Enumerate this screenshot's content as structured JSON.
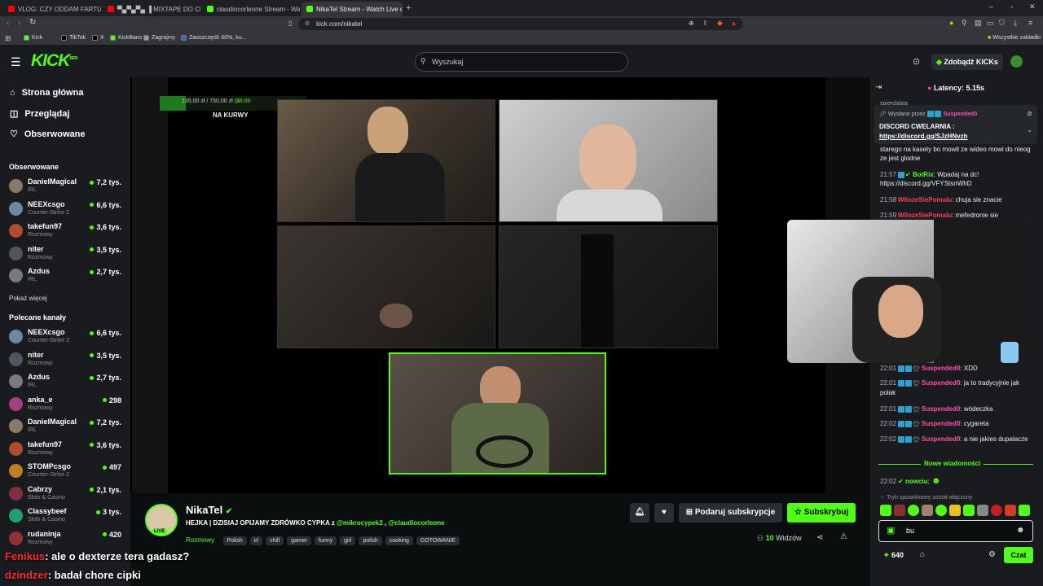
{
  "browser": {
    "tabs": [
      {
        "title": "VLOG: CZY ODDAM FARTUCHA? ‼",
        "color": "#ff0000"
      },
      {
        "title": "▀▄▀▄▀▄ ▐ MIXTAPE DO CH...",
        "color": "#ff0000"
      },
      {
        "title": "claudiocorleone Stream - Watch",
        "color": "#53fc18"
      },
      {
        "title": "NikaTel Stream - Watch Live o",
        "color": "#53fc18"
      }
    ],
    "url": "kick.com/nikatel",
    "bookmarks": [
      "Kick",
      "TikTok",
      "X",
      "KickBans",
      "Zagrajmy",
      "Zaoszczędź 60%, ku..."
    ],
    "all_bookmarks": "Wszystkie zakładki"
  },
  "header": {
    "logo": "KICK",
    "logo_sup": "BETA",
    "search_placeholder": "Wyszukaj",
    "kicks_button": "Zdobądź KICKs"
  },
  "sidebar": {
    "nav": [
      {
        "label": "Strona główna",
        "icon": "home-icon"
      },
      {
        "label": "Przeglądaj",
        "icon": "browse-icon"
      },
      {
        "label": "Obserwowane",
        "icon": "heart-icon"
      }
    ],
    "followed_title": "Obserwowane",
    "followed": [
      {
        "name": "DanielMagical",
        "category": "IRL",
        "viewers": "7,2 tys.",
        "color": "#8a7a6a"
      },
      {
        "name": "NEEXcsgo",
        "category": "Counter-Strike 2",
        "viewers": "6,6 tys.",
        "color": "#6a8aa0"
      },
      {
        "name": "takefun97",
        "category": "Rozmowy",
        "viewers": "3,6 tys.",
        "color": "#b04a30"
      },
      {
        "name": "niter",
        "category": "Rozmowy",
        "viewers": "3,5 tys.",
        "color": "#505560"
      },
      {
        "name": "Azdus",
        "category": "IRL",
        "viewers": "2,7 tys.",
        "color": "#777a80"
      }
    ],
    "show_more": "Pokaż więcej",
    "recommended_title": "Polecane kanały",
    "recommended": [
      {
        "name": "NEEXcsgo",
        "category": "Counter-Strike 2",
        "viewers": "6,6 tys.",
        "color": "#6a8aa0"
      },
      {
        "name": "niter",
        "category": "Rozmowy",
        "viewers": "3,5 tys.",
        "color": "#505560"
      },
      {
        "name": "Azdus",
        "category": "IRL",
        "viewers": "2,7 tys.",
        "color": "#777a80"
      },
      {
        "name": "anka_e",
        "category": "Rozmowy",
        "viewers": "298",
        "color": "#a04080"
      },
      {
        "name": "DanielMagical",
        "category": "IRL",
        "viewers": "7,2 tys.",
        "color": "#8a7a6a"
      },
      {
        "name": "takefun97",
        "category": "Rozmowy",
        "viewers": "3,6 tys.",
        "color": "#b04a30"
      },
      {
        "name": "STOMPcsgo",
        "category": "Counter-Strike 2",
        "viewers": "497",
        "color": "#c08020"
      },
      {
        "name": "Cabrzy",
        "category": "Slots & Casino",
        "viewers": "2,1 tys.",
        "color": "#803040"
      },
      {
        "name": "Classybeef",
        "category": "Slots & Casino",
        "viewers": "3 tys.",
        "color": "#20a070"
      },
      {
        "name": "rudaninja",
        "category": "Rozmowy",
        "viewers": "420",
        "color": "#903030"
      }
    ],
    "show_more_bottom": "Pokaż więcej"
  },
  "video": {
    "goal_text": "135,00 zł / 750,00 zł",
    "goal_extra": "($8.00",
    "goal_fraction": 0.18,
    "overlay_text": "NA KURWY"
  },
  "stream": {
    "channel": "NikaTel",
    "live_badge": "LIVE",
    "title_prefix": "HEJKA | DZISIAJ OPIJAMY ZDRÓWKO CYPKA z ",
    "mention1": "@mikrocypek2",
    "sep": " , ",
    "mention2": "@claudiocorleone",
    "category": "Rozmowy",
    "tags": [
      "Polish",
      "irl",
      "chill",
      "gamer",
      "funny",
      "girl",
      "polish",
      "cooking",
      "GOTOWANIE"
    ],
    "gift_button": "Podaruj subskrypcje",
    "subscribe_button": "Subskrybuj",
    "viewers_count": "10",
    "viewers_label": "Widzów"
  },
  "chat": {
    "latency": "Latency: 5.15s",
    "pinned_by": "Wysłane przez",
    "pinned_user": "Suspended0",
    "pinned_text": "DISCORD CWELARNIA :",
    "pinned_link": "https://discord.gg/SJzHNvzh",
    "top_fragment": "spierdalaja",
    "messages_top": [
      {
        "time": "",
        "user": "",
        "text": "starego na kasety bo mowil ze wideo mowi do nieog ze jest glodne"
      },
      {
        "time": "21:57",
        "user": "BotRix",
        "text": "Wpadaj na dc! https://discord.gg/VFYStsnWhD"
      },
      {
        "time": "21:58",
        "user": "WilozeSiePomalu",
        "text": "chuja sie znacie"
      },
      {
        "time": "21:59",
        "user": "WilozeSiePomalu",
        "text": "mefedronie sie"
      }
    ],
    "messages_bottom": [
      {
        "time": "22:01",
        "user": "Suspended0",
        "text": "XDD"
      },
      {
        "time": "22:01",
        "user": "Suspended0",
        "text": "ja to tradycyjnie jak polak"
      },
      {
        "time": "22:01",
        "user": "Suspended0",
        "text": "wódeczka"
      },
      {
        "time": "22:02",
        "user": "Suspended0",
        "text": "cygareta"
      },
      {
        "time": "22:02",
        "user": "Suspended0",
        "text": "a nie jakies dupalacze"
      }
    ],
    "new_messages": "Nowe wiadomości",
    "last_msg": {
      "time": "22:02",
      "user": "nowciu",
      "text": ""
    },
    "slow_mode": "Tryb spowolniony został włączony",
    "input_value": "bu",
    "points": "640",
    "send_button": "Czat"
  },
  "subtitles": [
    {
      "user": "Fenikus",
      "text": ": ale o dexterze tera gadasz?"
    },
    {
      "user": "dzindzer",
      "text": ": badał chore cipki"
    }
  ]
}
